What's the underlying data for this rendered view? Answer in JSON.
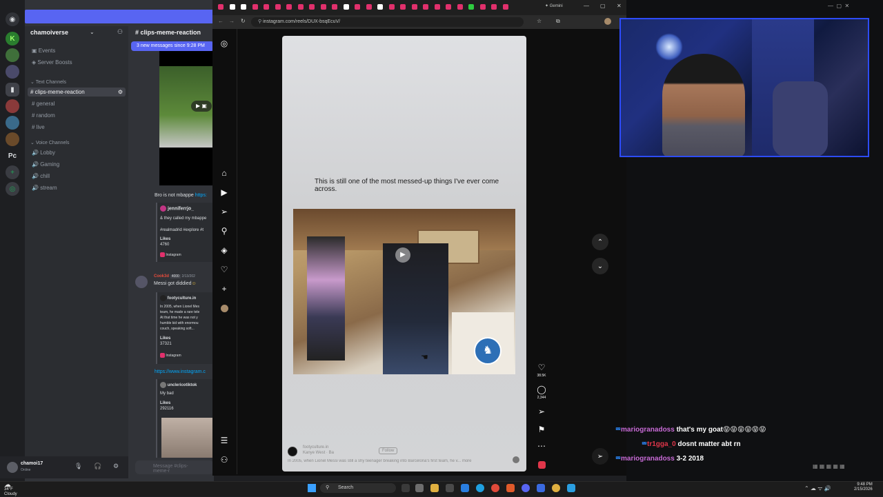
{
  "discord": {
    "server_name": "chamoiverse",
    "top_items": [
      "Events",
      "Server Boosts"
    ],
    "text_category": "Text Channels",
    "text_channels": [
      "clips-meme-reaction",
      "general",
      "random",
      "live"
    ],
    "voice_category": "Voice Channels",
    "voice_channels": [
      "Lobby",
      "Gaming",
      "chill",
      "stream"
    ],
    "current_channel": "clips-meme-reaction",
    "new_messages_banner": "3 new messages since 9:28 PM",
    "messages": [
      {
        "text": "Bro is not mbappe",
        "link": "https:"
      },
      {
        "embed_author": "jenniferrjo_",
        "embed_text": "& they called my mbappe",
        "embed_tags": "#realmadrid #explore #t",
        "likes_label": "Likes",
        "likes": "4760",
        "source": "Instagram"
      },
      {
        "author": "Cook3d",
        "badge": "4000",
        "date": "2/13/202",
        "text": "Messi got diddied"
      },
      {
        "embed_author": "footyculture.in",
        "embed_text_lines": [
          "In 2005, when Lionel Mes",
          "team, he made a rare tele",
          "At that time he was not y",
          "humble kid with enormou",
          "couch, speaking soft..."
        ],
        "likes_label": "Likes",
        "likes": "37321",
        "source": "Instagram"
      },
      {
        "link": "https://www.instagram.c"
      },
      {
        "embed_author": "unclericotiktok",
        "embed_text": "My bad",
        "likes_label": "Likes",
        "likes": "292116"
      }
    ],
    "user": {
      "name": "chamoi17",
      "status": "Online"
    },
    "input_placeholder": "Message #clips-meme-r"
  },
  "browser": {
    "url": "instagram.com/reels/DUX-bsqEcuV/",
    "tab_label": "Gemini",
    "reel": {
      "caption": "This is still one of the most messed-up things I've ever come across.",
      "author": "footyculture.in",
      "author_sub": "Kanye West · Ba",
      "follow": "Follow",
      "description": "In 2005, when Lionel Messi was still a shy teenager breaking into Barcelona's first team, he v... more",
      "likes": "38.5K",
      "comments": "2,344"
    }
  },
  "stream_chat": [
    {
      "user": "mariogranadoss",
      "message": "that's my goat😝😝😝😝😝😝",
      "color": "#c86bd6"
    },
    {
      "user": "tr1gga_0",
      "message": "dosnt matter abt rn",
      "color": "#e0364a"
    },
    {
      "user": "mariogranadoss",
      "message": "3-2 2018",
      "color": "#c86bd6"
    }
  ],
  "taskbar": {
    "weather_temp": "34°F",
    "weather_desc": "Cloudy",
    "search": "Search",
    "time": "9:48 PM",
    "date": "2/15/2026"
  },
  "colors": {
    "discord_accent": "#5865f2",
    "cam_border": "#2d4cff"
  }
}
